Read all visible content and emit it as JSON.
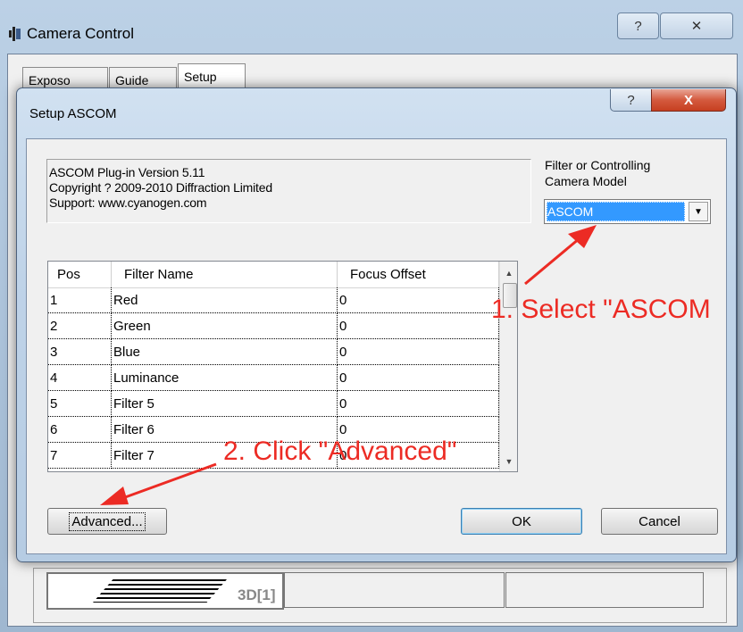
{
  "back_window": {
    "title": "Camera Control",
    "help_glyph": "?",
    "close_glyph": "✕",
    "tabs": [
      {
        "label": "Exposo"
      },
      {
        "label": "Guide"
      },
      {
        "label": "Setup"
      }
    ],
    "panel_label": "3D[1]"
  },
  "dialog": {
    "title": "Setup ASCOM",
    "help_glyph": "?",
    "close_glyph": "X",
    "info": {
      "line1": "ASCOM Plug-in Version 5.11",
      "line2": "Copyright ? 2009-2010 Diffraction Limited",
      "line3": "Support: www.cyanogen.com"
    },
    "filter_label_line1": "Filter or Controlling",
    "filter_label_line2": "Camera Model",
    "camera_model": {
      "selected": "ASCOM"
    },
    "table": {
      "headers": {
        "pos": "Pos",
        "name": "Filter Name",
        "offset": "Focus Offset"
      },
      "rows": [
        {
          "pos": "1",
          "name": "Red",
          "offset": "0"
        },
        {
          "pos": "2",
          "name": "Green",
          "offset": "0"
        },
        {
          "pos": "3",
          "name": "Blue",
          "offset": "0"
        },
        {
          "pos": "4",
          "name": "Luminance",
          "offset": "0"
        },
        {
          "pos": "5",
          "name": "Filter 5",
          "offset": "0"
        },
        {
          "pos": "6",
          "name": "Filter 6",
          "offset": "0"
        },
        {
          "pos": "7",
          "name": "Filter 7",
          "offset": "0"
        }
      ]
    },
    "buttons": {
      "advanced": "Advanced...",
      "ok": "OK",
      "cancel": "Cancel"
    }
  },
  "annotations": {
    "step1": "1. Select \"ASCOM",
    "step2": "2. Click \"Advanced\"",
    "color": "#ec2b24"
  }
}
